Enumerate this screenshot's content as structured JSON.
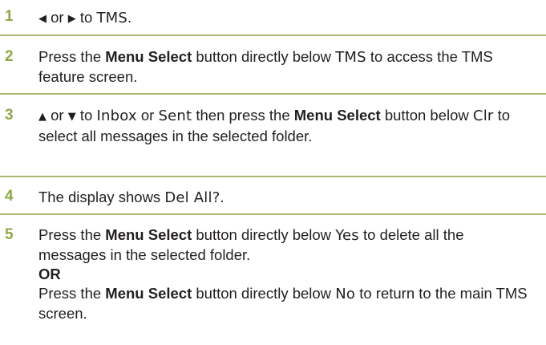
{
  "steps": [
    {
      "num": "1",
      "arrow_left": "◀",
      "or": "or",
      "arrow_right": "▶",
      "to": "to",
      "target": "TMS",
      "end": "."
    },
    {
      "num": "2",
      "pre": "Press the ",
      "btn": "Menu Select",
      "mid": " button directly below ",
      "lcd": "TMS",
      "post": " to access the TMS feature screen."
    },
    {
      "num": "3",
      "arrow_up": "▲",
      "or": "or",
      "arrow_down": "▼",
      "to": "to",
      "lcd1": "Inbox",
      "or2": "or",
      "lcd2": "Sent",
      "then": "then press the",
      "btn": "Menu Select",
      "mid": "button below",
      "lcd3": "Clr",
      "post": "to select all messages in the selected folder."
    },
    {
      "num": "4",
      "pre": "The display shows ",
      "lcd": "Del All?",
      "end": "."
    },
    {
      "num": "5",
      "pre": "Press the ",
      "btn": "Menu Select",
      "mid": " button directly below ",
      "lcd": "Yes",
      "post": " to delete all the messages in the selected folder.",
      "or": "OR",
      "pre2": "Press the ",
      "btn2": "Menu Select",
      "mid2": " button directly below ",
      "lcd2": "No",
      "post2": " to return to the main TMS screen."
    }
  ]
}
